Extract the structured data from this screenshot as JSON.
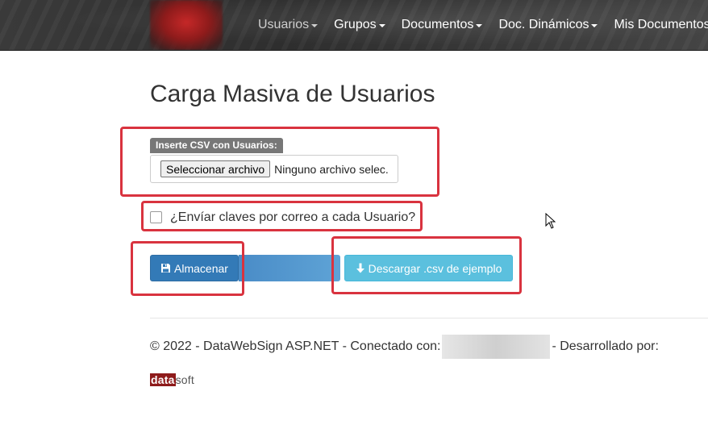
{
  "nav": {
    "items": [
      {
        "label": "Usuarios",
        "active": true
      },
      {
        "label": "Grupos",
        "active": false
      },
      {
        "label": "Documentos",
        "active": false
      },
      {
        "label": "Doc. Dinámicos",
        "active": false
      },
      {
        "label": "Mis Documentos",
        "active": false
      }
    ]
  },
  "page": {
    "title": "Carga Masiva de Usuarios"
  },
  "upload": {
    "label": "Inserte CSV con Usuarios:",
    "button_label": "Seleccionar archivo",
    "status": "Ninguno archivo selec."
  },
  "options": {
    "send_passwords_label": "¿Envíar claves por correo a cada Usuario?",
    "send_passwords_checked": false
  },
  "actions": {
    "save_label": "Almacenar",
    "download_label": "Descargar .csv de ejemplo"
  },
  "footer": {
    "text_before": "© 2022 - DataWebSign ASP.NET - Conectado con:",
    "text_after": "- Desarrollado por:",
    "logo_part1": "data",
    "logo_part2": "soft"
  },
  "colors": {
    "primary": "#337ab7",
    "info": "#5bc0de",
    "highlight": "#d9333f",
    "label_bg": "#777777"
  }
}
